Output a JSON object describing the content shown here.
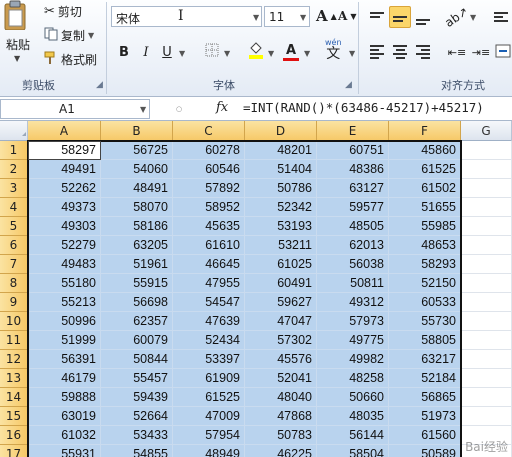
{
  "clipboard": {
    "paste_label": "粘贴",
    "cut_label": "剪切",
    "copy_label": "复制",
    "format_painter_label": "格式刷",
    "group_label": "剪贴板"
  },
  "font": {
    "name": "宋体",
    "size": "11",
    "bold": "B",
    "italic": "I",
    "underline": "U",
    "grow": "A",
    "shrink": "A",
    "font_color_glyph": "A",
    "wen_glyph": "wén",
    "wen_char": "文",
    "group_label": "字体"
  },
  "alignment": {
    "group_label": "对齐方式"
  },
  "formula_bar": {
    "name_box": "A1",
    "fx": "fx",
    "formula": "=INT(RAND()*(63486-45217)+45217)"
  },
  "columns": [
    "A",
    "B",
    "C",
    "D",
    "E",
    "F",
    "G"
  ],
  "rows": [
    {
      "n": "1",
      "v": [
        "58297",
        "56725",
        "60278",
        "48201",
        "60751",
        "45860"
      ]
    },
    {
      "n": "2",
      "v": [
        "49491",
        "54060",
        "60546",
        "51404",
        "48386",
        "61525"
      ]
    },
    {
      "n": "3",
      "v": [
        "52262",
        "48491",
        "57892",
        "50786",
        "63127",
        "61502"
      ]
    },
    {
      "n": "4",
      "v": [
        "49373",
        "58070",
        "58952",
        "52342",
        "59577",
        "51655"
      ]
    },
    {
      "n": "5",
      "v": [
        "49303",
        "58186",
        "45635",
        "53193",
        "48505",
        "55985"
      ]
    },
    {
      "n": "6",
      "v": [
        "52279",
        "63205",
        "61610",
        "53211",
        "62013",
        "48653"
      ]
    },
    {
      "n": "7",
      "v": [
        "49483",
        "51961",
        "46645",
        "61025",
        "56038",
        "58293"
      ]
    },
    {
      "n": "8",
      "v": [
        "55180",
        "55915",
        "47955",
        "60491",
        "50811",
        "52150"
      ]
    },
    {
      "n": "9",
      "v": [
        "55213",
        "56698",
        "54547",
        "59627",
        "49312",
        "60533"
      ]
    },
    {
      "n": "10",
      "v": [
        "50996",
        "62357",
        "47639",
        "47047",
        "57973",
        "55730"
      ]
    },
    {
      "n": "11",
      "v": [
        "51999",
        "60079",
        "52434",
        "57302",
        "49775",
        "58805"
      ]
    },
    {
      "n": "12",
      "v": [
        "56391",
        "50844",
        "53397",
        "45576",
        "49982",
        "63217"
      ]
    },
    {
      "n": "13",
      "v": [
        "46179",
        "55457",
        "61909",
        "52041",
        "48258",
        "52184"
      ]
    },
    {
      "n": "14",
      "v": [
        "59888",
        "59439",
        "61525",
        "48040",
        "50660",
        "56865"
      ]
    },
    {
      "n": "15",
      "v": [
        "63019",
        "52664",
        "47009",
        "47868",
        "48035",
        "51973"
      ]
    },
    {
      "n": "16",
      "v": [
        "61032",
        "53433",
        "57954",
        "50783",
        "56144",
        "61560"
      ]
    },
    {
      "n": "17",
      "v": [
        "55931",
        "54855",
        "48949",
        "46225",
        "58504",
        "50589"
      ]
    }
  ],
  "watermark": "Bai经验",
  "colors": {
    "selection_fill": "#b9d3ee",
    "header_selected": "#f6c866",
    "active_align": "#fbd66a"
  }
}
